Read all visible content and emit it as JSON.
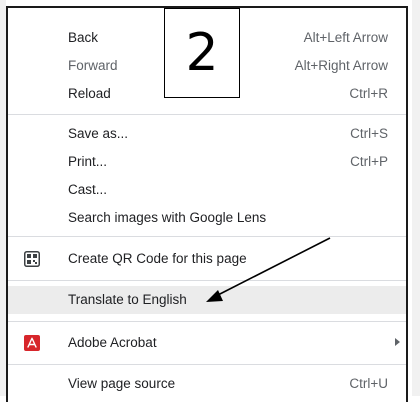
{
  "annotation": {
    "number": "2"
  },
  "menu": {
    "items": [
      {
        "label": "Back",
        "shortcut": "Alt+Left Arrow",
        "disabled": false
      },
      {
        "label": "Forward",
        "shortcut": "Alt+Right Arrow",
        "disabled": true
      },
      {
        "label": "Reload",
        "shortcut": "Ctrl+R",
        "disabled": false
      },
      {
        "label": "Save as...",
        "shortcut": "Ctrl+S",
        "disabled": false
      },
      {
        "label": "Print...",
        "shortcut": "Ctrl+P",
        "disabled": false
      },
      {
        "label": "Cast...",
        "shortcut": "",
        "disabled": false
      },
      {
        "label": "Search images with Google Lens",
        "shortcut": "",
        "disabled": false
      },
      {
        "label": "Create QR Code for this page",
        "shortcut": "",
        "icon": "qr-code-icon"
      },
      {
        "label": "Translate to English",
        "shortcut": "",
        "highlighted": true
      },
      {
        "label": "Adobe Acrobat",
        "shortcut": "",
        "icon": "adobe-acrobat-icon",
        "submenu": true
      },
      {
        "label": "View page source",
        "shortcut": "Ctrl+U"
      }
    ]
  },
  "colors": {
    "highlight": "#ececec",
    "acrobat_red": "#d7262b"
  }
}
